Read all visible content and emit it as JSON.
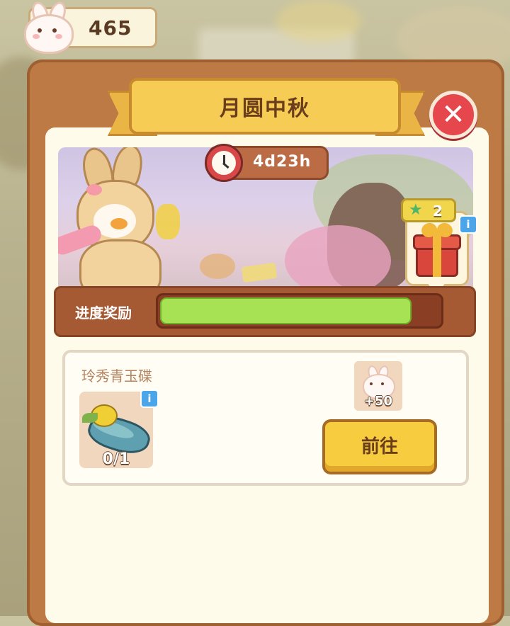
{
  "currency": {
    "amount": "465",
    "icon": "bunny-icon"
  },
  "panel": {
    "title": "月圆中秋",
    "close_icon": "close-icon"
  },
  "event": {
    "timer_icon": "clock-icon",
    "time_left": "4d23h"
  },
  "milestone_reward": {
    "icon": "gift-box-icon",
    "star_icon": "star-icon",
    "count": "2",
    "info_icon": "info-icon",
    "info_label": "i"
  },
  "progress": {
    "label": "进度奖励",
    "value_fraction": 0.9
  },
  "task": {
    "name": "玲秀青玉碟",
    "item_icon": "jade-plate-icon",
    "item_progress": "0/1",
    "info_label": "i",
    "reward_icon": "bunny-icon",
    "reward_amount": "+50",
    "go_button": "前往"
  },
  "colors": {
    "panel_brown": "#bd7a45",
    "title_yellow": "#f7cc55",
    "close_red": "#e6474d",
    "progress_green": "#a6e254",
    "button_yellow": "#f7cc3f"
  }
}
